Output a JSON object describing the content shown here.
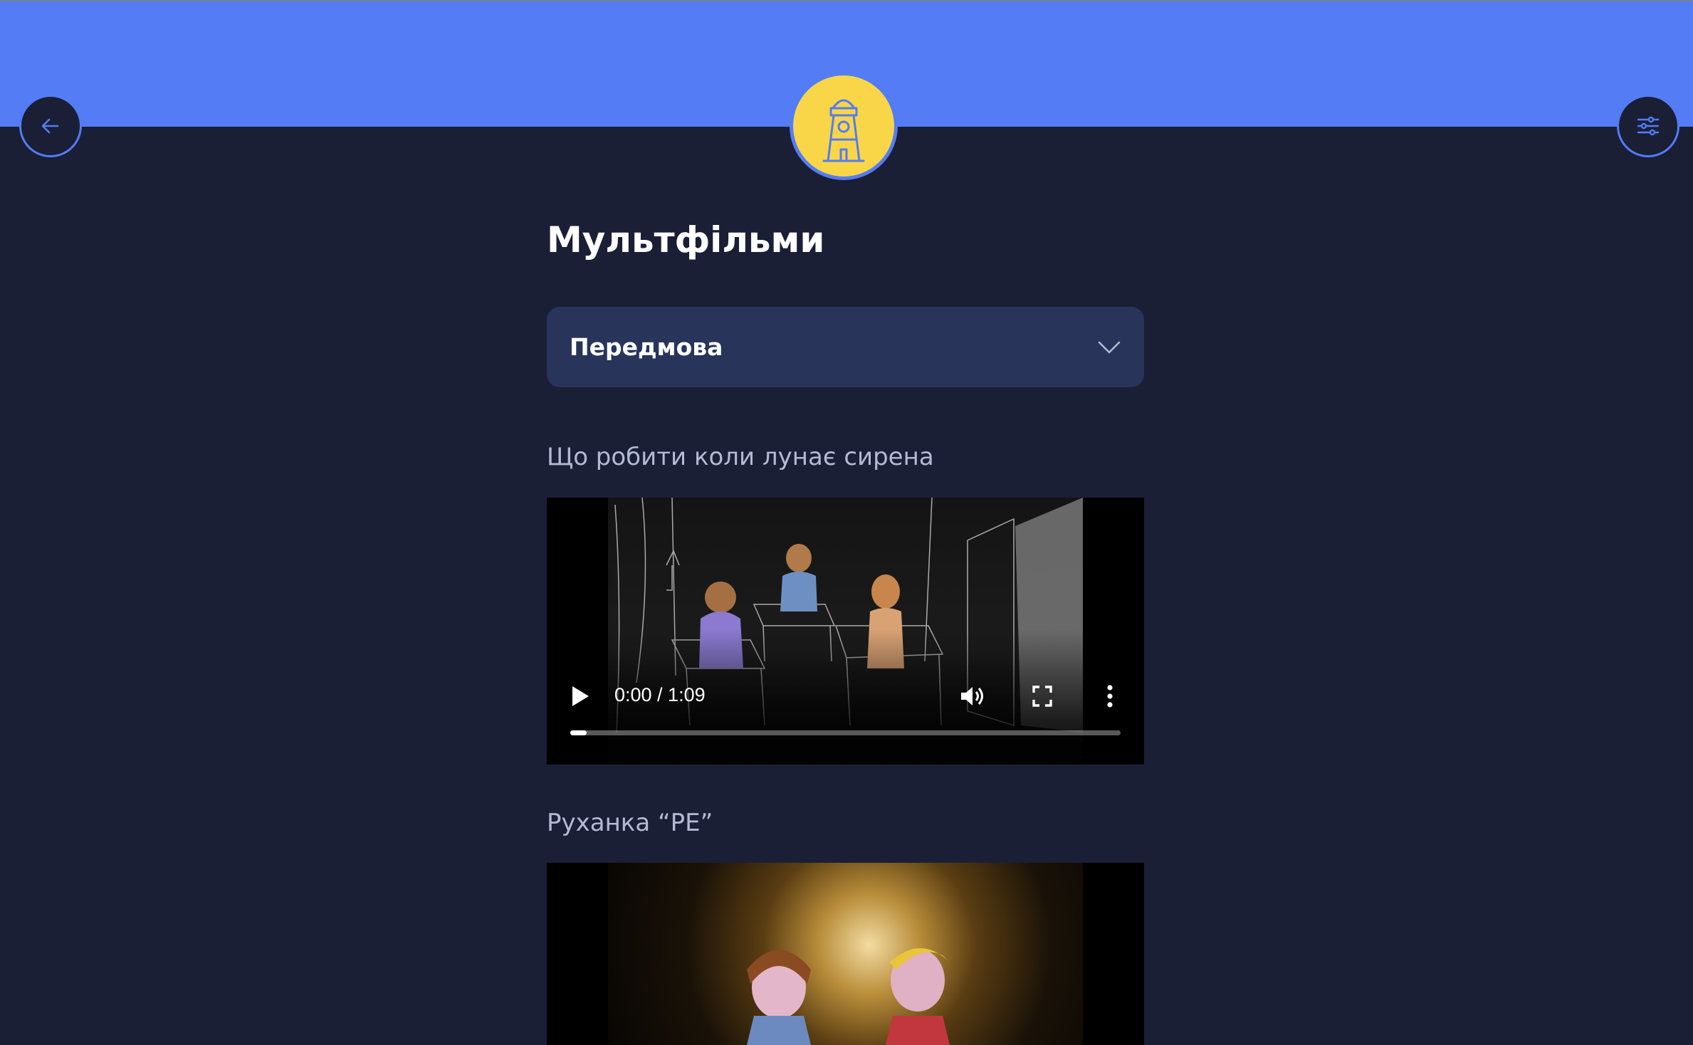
{
  "header": {
    "back_icon": "arrow-left-icon",
    "settings_icon": "sliders-icon",
    "logo_icon": "lighthouse-icon",
    "colors": {
      "header_bg": "#537cf5",
      "page_bg": "#1a1f36",
      "logo_bg": "#f9d648"
    }
  },
  "main": {
    "title": "Мультфільми",
    "accordion": {
      "label": "Передмова",
      "icon": "chevron-down-icon"
    },
    "videos": [
      {
        "title": "Що робити коли лунає сирена",
        "time": "0:00 / 1:09",
        "progress": 0.03,
        "controls": [
          "play-icon",
          "volume-icon",
          "fullscreen-icon",
          "more-vertical-icon"
        ]
      },
      {
        "title": "Руханка “PE”"
      }
    ]
  }
}
